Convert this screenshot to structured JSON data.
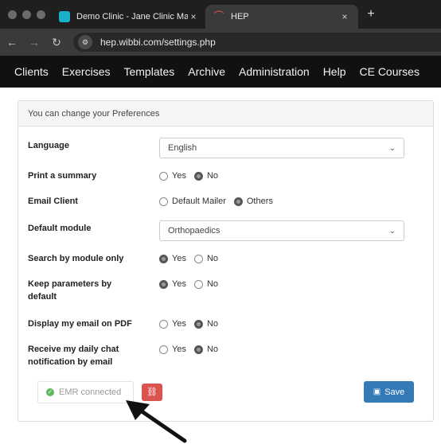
{
  "browser": {
    "tabs": [
      {
        "title": "Demo Clinic - Jane Clinic Mar",
        "active": false,
        "favicon_color": "#1ab0c8"
      },
      {
        "title": "HEP",
        "active": true,
        "favicon_color": "#e8534a"
      }
    ],
    "tab_close_glyph": "×",
    "new_tab_glyph": "+",
    "url": "hep.wibbi.com/settings.php"
  },
  "nav": {
    "items": [
      "Clients",
      "Exercises",
      "Templates",
      "Archive",
      "Administration",
      "Help",
      "CE Courses"
    ]
  },
  "panel": {
    "heading": "You can change your Preferences",
    "rows": [
      {
        "label": "Language",
        "type": "select",
        "value": "English"
      },
      {
        "label": "Print a summary",
        "type": "radio",
        "options": [
          "Yes",
          "No"
        ],
        "selected": "No"
      },
      {
        "label": "Email Client",
        "type": "radio",
        "options": [
          "Default Mailer",
          "Others"
        ],
        "selected": "Others"
      },
      {
        "label": "Default module",
        "type": "select",
        "value": "Orthopaedics"
      },
      {
        "label": "Search by module only",
        "type": "radio",
        "options": [
          "Yes",
          "No"
        ],
        "selected": "Yes"
      },
      {
        "label": "Keep parameters by default",
        "type": "radio",
        "options": [
          "Yes",
          "No"
        ],
        "selected": "Yes"
      },
      {
        "label": "Display my email on PDF",
        "type": "radio",
        "options": [
          "Yes",
          "No"
        ],
        "selected": "No"
      },
      {
        "label": "Receive my daily chat notification by email",
        "type": "radio",
        "options": [
          "Yes",
          "No"
        ],
        "selected": "No"
      }
    ],
    "emr_status": "EMR connected",
    "save_label": "Save"
  },
  "colors": {
    "save_button": "#337ab7",
    "unlink_button": "#d9534f",
    "emr_check": "#5cb85c"
  }
}
